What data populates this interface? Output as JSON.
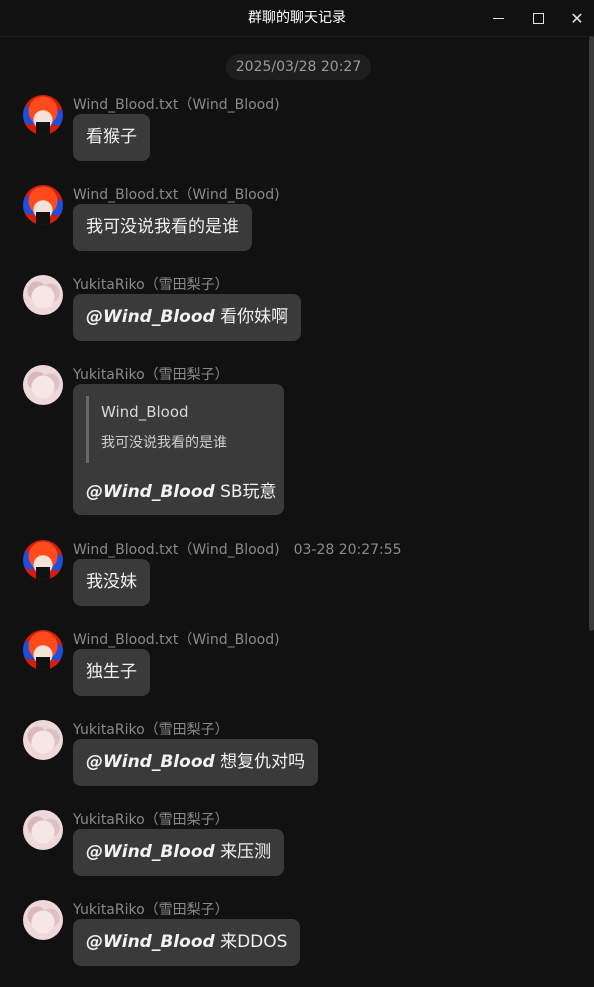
{
  "window": {
    "title": "群聊的聊天记录"
  },
  "date_separator": "2025/03/28 20:27",
  "messages": [
    {
      "sender": "Wind_Blood.txt（Wind_Blood)",
      "avatar": "wind-blood-avatar",
      "text": "看猴子"
    },
    {
      "sender": "Wind_Blood.txt（Wind_Blood)",
      "avatar": "wind-blood-avatar",
      "text": "我可没说我看的是谁"
    },
    {
      "sender": "YukitaRiko（雪田梨子）",
      "avatar": "yukitariko-avatar",
      "mention": "@Wind_Blood",
      "text": " 看你妹啊"
    },
    {
      "sender": "YukitaRiko（雪田梨子）",
      "avatar": "yukitariko-avatar",
      "quote": {
        "name": "Wind_Blood",
        "text": "我可没说我看的是谁"
      },
      "mention": "@Wind_Blood",
      "text": " SB玩意"
    },
    {
      "sender": "Wind_Blood.txt（Wind_Blood)",
      "time": "03-28 20:27:55",
      "avatar": "wind-blood-avatar",
      "text": "我没妹"
    },
    {
      "sender": "Wind_Blood.txt（Wind_Blood)",
      "avatar": "wind-blood-avatar",
      "text": "独生子"
    },
    {
      "sender": "YukitaRiko（雪田梨子）",
      "avatar": "yukitariko-avatar",
      "mention": "@Wind_Blood",
      "text": " 想复仇对吗"
    },
    {
      "sender": "YukitaRiko（雪田梨子）",
      "avatar": "yukitariko-avatar",
      "mention": "@Wind_Blood",
      "text": " 来压测"
    },
    {
      "sender": "YukitaRiko（雪田梨子）",
      "avatar": "yukitariko-avatar",
      "mention": "@Wind_Blood",
      "text": " 来DDOS"
    }
  ],
  "icons": {
    "minimize": "minimize-icon",
    "maximize": "maximize-icon",
    "close": "close-icon"
  }
}
